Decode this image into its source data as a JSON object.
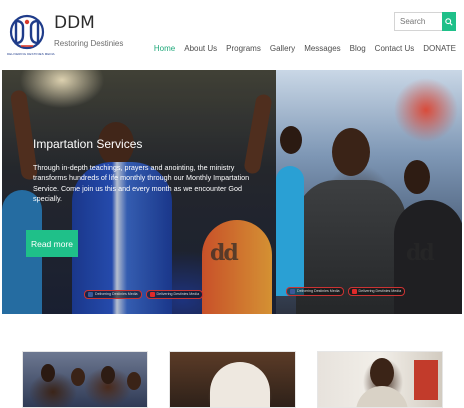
{
  "brand": {
    "title": "DDM",
    "tagline": "Restoring Destinies",
    "logo_caption": "DELIVERING DESTINIES MEDIA",
    "logo_icon": "ddm-logo-icon"
  },
  "search": {
    "placeholder": "Search",
    "button_icon": "search-icon"
  },
  "nav": {
    "items": [
      {
        "label": "Home",
        "active": true
      },
      {
        "label": "About Us"
      },
      {
        "label": "Programs"
      },
      {
        "label": "Gallery"
      },
      {
        "label": "Messages"
      },
      {
        "label": "Blog"
      },
      {
        "label": "Contact Us"
      },
      {
        "label": "DONATE"
      }
    ]
  },
  "hero": {
    "title": "Impartation Services",
    "text": "Through in-depth teachings, prayers and anointing, the ministry transforms hundreds of life monthly through our Monthly Impartation Service. Come join us this and every month as we encounter God specially.",
    "button_label": "Read more",
    "watermark_left": {
      "mark": "dd",
      "facebook_label": "Delivering Destinies Media",
      "youtube_label": "Delivering Destinies Media"
    },
    "watermark_right": {
      "mark": "dd",
      "facebook_label": "Delivering Destinies Media",
      "youtube_label": "Delivering Destinies Media"
    }
  },
  "colors": {
    "accent": "#1fc089",
    "nav_active": "#1fa87a",
    "logo_blue": "#1f3c8a"
  }
}
